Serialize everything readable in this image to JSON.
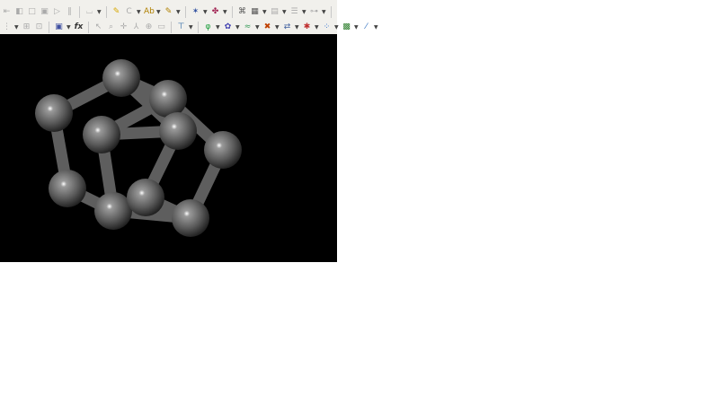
{
  "toolbar_row1": [
    {
      "icon": "first-icon",
      "color": "#aaa",
      "glyph": "⇤"
    },
    {
      "icon": "prev-icon",
      "color": "#aaa",
      "glyph": "◧"
    },
    {
      "icon": "square-icon",
      "color": "#aaa",
      "glyph": "□"
    },
    {
      "icon": "frame-icon",
      "color": "#aaa",
      "glyph": "▣"
    },
    {
      "icon": "play-icon",
      "color": "#aaa",
      "glyph": "▷"
    },
    {
      "icon": "pause-icon",
      "color": "#aaa",
      "glyph": "‖"
    },
    {
      "icon": "measure-icon",
      "color": "#aaa",
      "glyph": "⌴",
      "dd": true
    },
    {
      "icon": "pencil-icon",
      "color": "#d8a800",
      "glyph": "✎"
    },
    {
      "icon": "c-icon",
      "color": "#aaa",
      "glyph": "C",
      "dd": true
    },
    {
      "icon": "label-icon",
      "color": "#b08000",
      "glyph": "Ab",
      "dd": true
    },
    {
      "icon": "highlight-icon",
      "color": "#b08000",
      "glyph": "✎",
      "dd": true
    },
    {
      "icon": "molecule-icon",
      "color": "#3050a0",
      "glyph": "✶",
      "dd": true
    },
    {
      "icon": "fragment-icon",
      "color": "#a02050",
      "glyph": "✤",
      "dd": true
    },
    {
      "icon": "bond-icon",
      "color": "#555",
      "glyph": "⌘"
    },
    {
      "icon": "grid-icon",
      "color": "#555",
      "glyph": "▦",
      "dd": true
    },
    {
      "icon": "table-icon",
      "color": "#aaa",
      "glyph": "▤",
      "dd": true
    },
    {
      "icon": "list-icon",
      "color": "#aaa",
      "glyph": "☰",
      "dd": true
    },
    {
      "icon": "tree-icon",
      "color": "#aaa",
      "glyph": "⊶",
      "dd": true
    }
  ],
  "toolbar_row2": [
    {
      "icon": "grip-icon",
      "color": "#aaa",
      "glyph": "⋮",
      "dd": true
    },
    {
      "icon": "save-icon",
      "color": "#aaa",
      "glyph": "⊞"
    },
    {
      "icon": "export-icon",
      "color": "#aaa",
      "glyph": "⊡"
    },
    {
      "icon": "floppy-icon",
      "color": "#4050a0",
      "glyph": "▣",
      "dd": true
    },
    {
      "icon": "cursor-icon",
      "color": "#aaa",
      "glyph": "↖"
    },
    {
      "icon": "zoom-icon",
      "color": "#aaa",
      "glyph": "⌕"
    },
    {
      "icon": "move-icon",
      "color": "#aaa",
      "glyph": "✛"
    },
    {
      "icon": "rotate-icon",
      "color": "#aaa",
      "glyph": "⅄"
    },
    {
      "icon": "translate-icon",
      "color": "#aaa",
      "glyph": "⊕"
    },
    {
      "icon": "page-icon",
      "color": "#aaa",
      "glyph": "▭"
    },
    {
      "icon": "align-icon",
      "color": "#2060a0",
      "glyph": "⊤",
      "dd": true
    },
    {
      "icon": "phi-icon",
      "color": "#20a040",
      "glyph": "φ",
      "dd": true
    },
    {
      "icon": "ring-icon",
      "color": "#4040b0",
      "glyph": "✿",
      "dd": true
    },
    {
      "icon": "wave-icon",
      "color": "#40a060",
      "glyph": "≈",
      "dd": true
    },
    {
      "icon": "cluster-icon",
      "color": "#c04000",
      "glyph": "✖",
      "dd": true
    },
    {
      "icon": "link-icon",
      "color": "#4060a0",
      "glyph": "⇄",
      "dd": true
    },
    {
      "icon": "network-icon",
      "color": "#c03030",
      "glyph": "✱",
      "dd": true
    },
    {
      "icon": "atoms-icon",
      "color": "#3070d0",
      "glyph": "⁘",
      "dd": true
    },
    {
      "icon": "matrix-icon",
      "color": "#308030",
      "glyph": "▩",
      "dd": true
    },
    {
      "icon": "wand-icon",
      "color": "#3070c0",
      "glyph": "⁄",
      "dd": true
    }
  ],
  "formula_label": "fx"
}
